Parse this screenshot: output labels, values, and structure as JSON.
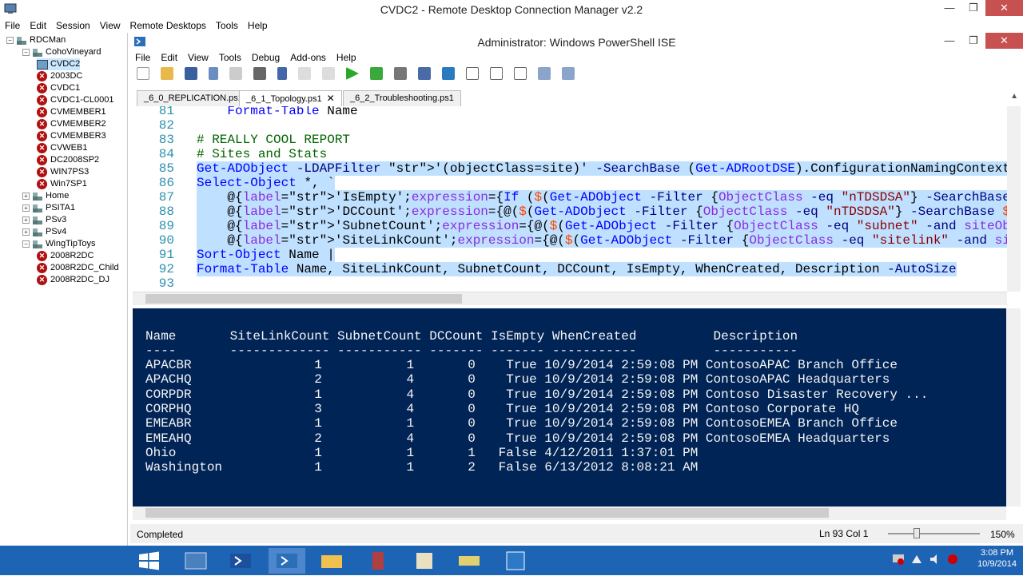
{
  "outer_window": {
    "title": "CVDC2 - Remote Desktop Connection Manager v2.2"
  },
  "outer_menu": [
    "File",
    "Edit",
    "Session",
    "View",
    "Remote Desktops",
    "Tools",
    "Help"
  ],
  "tree": [
    {
      "label": "RDCMan",
      "level": 0,
      "type": "root",
      "expanded": true
    },
    {
      "label": "CohoVineyard",
      "level": 1,
      "type": "group",
      "expanded": true
    },
    {
      "label": "CVDC2",
      "level": 2,
      "type": "connected",
      "selected": true
    },
    {
      "label": "2003DC",
      "level": 2,
      "type": "error"
    },
    {
      "label": "CVDC1",
      "level": 2,
      "type": "error"
    },
    {
      "label": "CVDC1-CL0001",
      "level": 2,
      "type": "error"
    },
    {
      "label": "CVMEMBER1",
      "level": 2,
      "type": "error"
    },
    {
      "label": "CVMEMBER2",
      "level": 2,
      "type": "error"
    },
    {
      "label": "CVMEMBER3",
      "level": 2,
      "type": "error"
    },
    {
      "label": "CVWEB1",
      "level": 2,
      "type": "error"
    },
    {
      "label": "DC2008SP2",
      "level": 2,
      "type": "error"
    },
    {
      "label": "WIN7PS3",
      "level": 2,
      "type": "error"
    },
    {
      "label": "Win7SP1",
      "level": 2,
      "type": "error"
    },
    {
      "label": "Home",
      "level": 1,
      "type": "group",
      "expanded": false
    },
    {
      "label": "PSITA1",
      "level": 1,
      "type": "group",
      "expanded": false
    },
    {
      "label": "PSv3",
      "level": 1,
      "type": "group",
      "expanded": false
    },
    {
      "label": "PSv4",
      "level": 1,
      "type": "group",
      "expanded": false
    },
    {
      "label": "WingTipToys",
      "level": 1,
      "type": "group",
      "expanded": true
    },
    {
      "label": "2008R2DC",
      "level": 2,
      "type": "error"
    },
    {
      "label": "2008R2DC_Child",
      "level": 2,
      "type": "error"
    },
    {
      "label": "2008R2DC_DJ",
      "level": 2,
      "type": "error"
    }
  ],
  "ise": {
    "title": "Administrator: Windows PowerShell ISE",
    "menu": [
      "File",
      "Edit",
      "View",
      "Tools",
      "Debug",
      "Add-ons",
      "Help"
    ],
    "tabs": [
      {
        "label": "_6_0_REPLICATION.ps1",
        "active": false
      },
      {
        "label": "_6_1_Topology.ps1",
        "active": true,
        "close": "✕"
      },
      {
        "label": "_6_2_Troubleshooting.ps1",
        "active": false
      }
    ],
    "code_lines": [
      {
        "num": "81",
        "text": "    Format-Table Name",
        "hl": false
      },
      {
        "num": "82",
        "text": "",
        "hl": false
      },
      {
        "num": "83",
        "text": "# REALLY COOL REPORT",
        "hl": false
      },
      {
        "num": "84",
        "text": "# Sites and Stats",
        "hl": false
      },
      {
        "num": "85",
        "text": "Get-ADObject -LDAPFilter '(objectClass=site)' -SearchBase (Get-ADRootDSE).ConfigurationNamingContext -Pr",
        "hl": true
      },
      {
        "num": "86",
        "text": "Select-Object *, `",
        "hl": true
      },
      {
        "num": "87",
        "text": "    @{label='IsEmpty';expression={If ($(Get-ADObject -Filter {ObjectClass -eq \"nTDSDSA\"} -SearchBase $_",
        "hl": true
      },
      {
        "num": "88",
        "text": "    @{label='DCCount';expression={@($(Get-ADObject -Filter {ObjectClass -eq \"nTDSDSA\"} -SearchBase $_.D",
        "hl": true
      },
      {
        "num": "89",
        "text": "    @{label='SubnetCount';expression={@($(Get-ADObject -Filter {ObjectClass -eq \"subnet\" -and siteObjec",
        "hl": true
      },
      {
        "num": "90",
        "text": "    @{label='SiteLinkCount';expression={@($(Get-ADObject -Filter {ObjectClass -eq \"sitelink\" -and siteL",
        "hl": true
      },
      {
        "num": "91",
        "text": "Sort-Object Name |",
        "hl": true
      },
      {
        "num": "92",
        "text": "Format-Table Name, SiteLinkCount, SubnetCount, DCCount, IsEmpty, WhenCreated, Description -AutoSize",
        "hl": true
      },
      {
        "num": "93",
        "text": "",
        "hl": false
      }
    ],
    "console": {
      "header": "Name       SiteLinkCount SubnetCount DCCount IsEmpty WhenCreated          Description",
      "separator": "----       ------------- ----------- ------- ------- -----------          -----------",
      "rows": [
        "APACBR                1           1       0    True 10/9/2014 2:59:08 PM ContosoAPAC Branch Office",
        "APACHQ                2           4       0    True 10/9/2014 2:59:08 PM ContosoAPAC Headquarters",
        "CORPDR                1           4       0    True 10/9/2014 2:59:08 PM Contoso Disaster Recovery ...",
        "CORPHQ                3           4       0    True 10/9/2014 2:59:08 PM Contoso Corporate HQ",
        "EMEABR                1           1       0    True 10/9/2014 2:59:08 PM ContosoEMEA Branch Office",
        "EMEAHQ                2           4       0    True 10/9/2014 2:59:08 PM ContosoEMEA Headquarters",
        "Ohio                  1           1       1   False 4/12/2011 1:37:01 PM",
        "Washington            1           1       2   False 6/13/2012 8:08:21 AM"
      ]
    },
    "status": {
      "text": "Completed",
      "position": "Ln 93  Col 1",
      "zoom": "150%"
    }
  },
  "taskbar": {
    "time": "3:08 PM",
    "date": "10/9/2014"
  },
  "colors": {
    "taskbar": "#1e64b4",
    "console_bg": "#012456",
    "selection": "#bfe0ff",
    "error_icon": "#b01010"
  }
}
